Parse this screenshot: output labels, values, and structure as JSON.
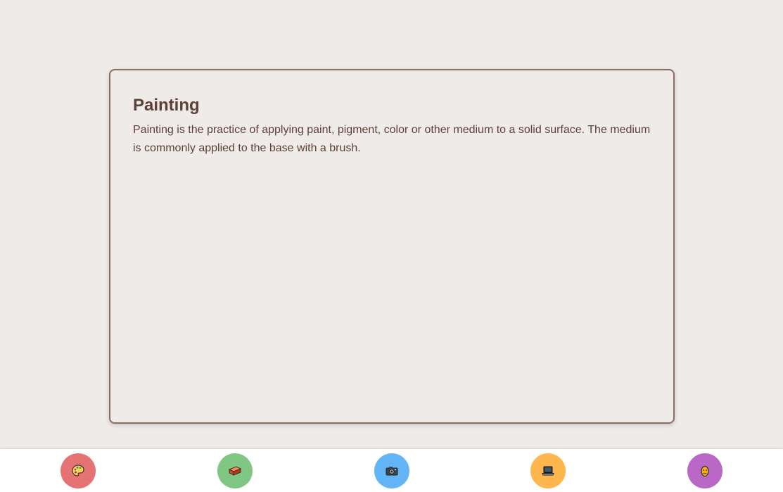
{
  "card": {
    "title": "Painting",
    "text": "Painting is the practice of applying paint, pigment, color or other medium to a solid surface. The medium is commonly applied to the base with a brush."
  },
  "nav": [
    {
      "icon": "palette-icon",
      "color": "#e57373"
    },
    {
      "icon": "brick-icon",
      "color": "#81c784"
    },
    {
      "icon": "camera-icon",
      "color": "#64b5f6"
    },
    {
      "icon": "laptop-icon",
      "color": "#ffb74d"
    },
    {
      "icon": "mask-icon",
      "color": "#ba68c8"
    }
  ],
  "colors": {
    "background": "#efebe8",
    "accent": "#8d6e63",
    "text": "#5d4037"
  }
}
